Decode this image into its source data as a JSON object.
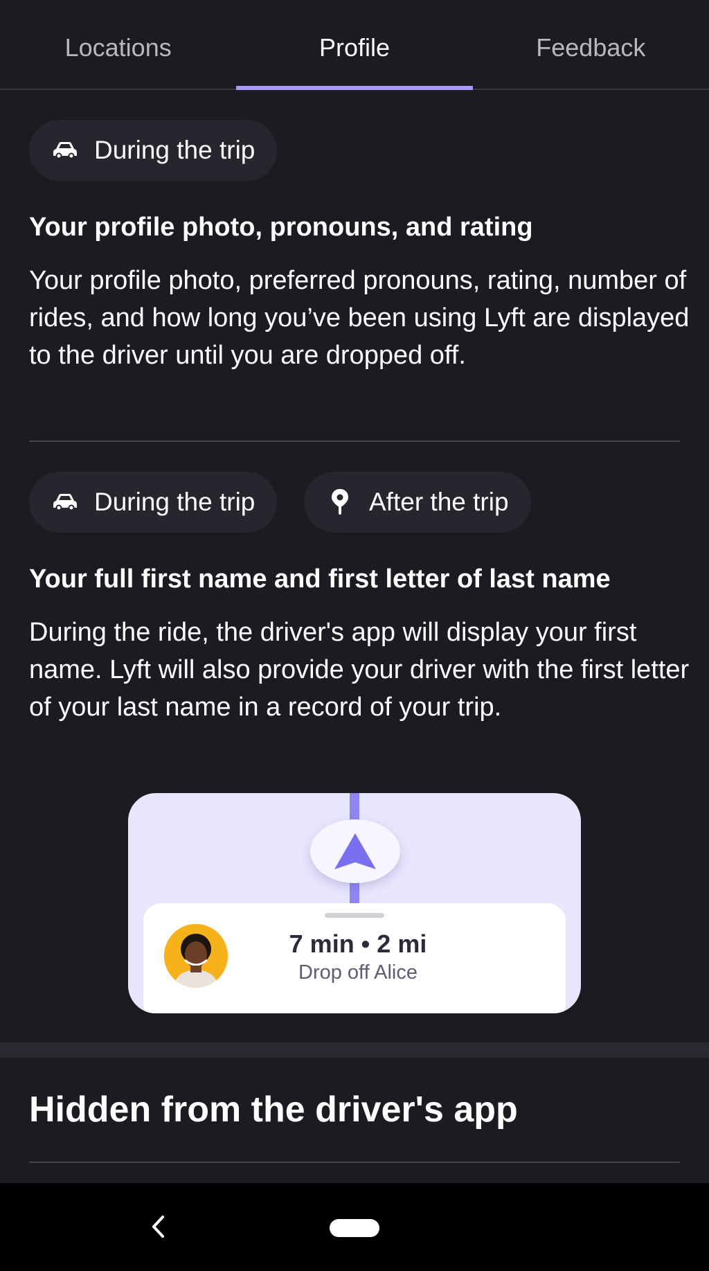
{
  "tabs": [
    {
      "label": "Locations",
      "active": false
    },
    {
      "label": "Profile",
      "active": true
    },
    {
      "label": "Feedback",
      "active": false
    }
  ],
  "section1": {
    "chip_label": "During the trip",
    "chip_icon": "car-icon",
    "title": "Your profile photo, pronouns, and rating",
    "body": "Your profile photo, preferred pronouns, rating, number of rides, and how long you’ve been using Lyft are displayed to the driver until you are dropped off."
  },
  "section2": {
    "chips": [
      {
        "label": "During the trip",
        "icon": "car-icon"
      },
      {
        "label": "After the trip",
        "icon": "location-pin-icon"
      }
    ],
    "title": "Your full first name and first letter of last name",
    "body": "During the ride, the driver's app will display your first name. Lyft will also provide your driver with the first letter of your last name in a record of your trip."
  },
  "illustration": {
    "trip_main": "7 min • 2 mi",
    "trip_sub": "Drop off Alice"
  },
  "hidden_section": {
    "title": "Hidden from the driver's app"
  },
  "colors": {
    "background": "#1b1b22",
    "accent": "#a99cf7",
    "chip": "#26262f",
    "illustration_bg": "#e8e6fd",
    "route": "#8f86f3"
  }
}
